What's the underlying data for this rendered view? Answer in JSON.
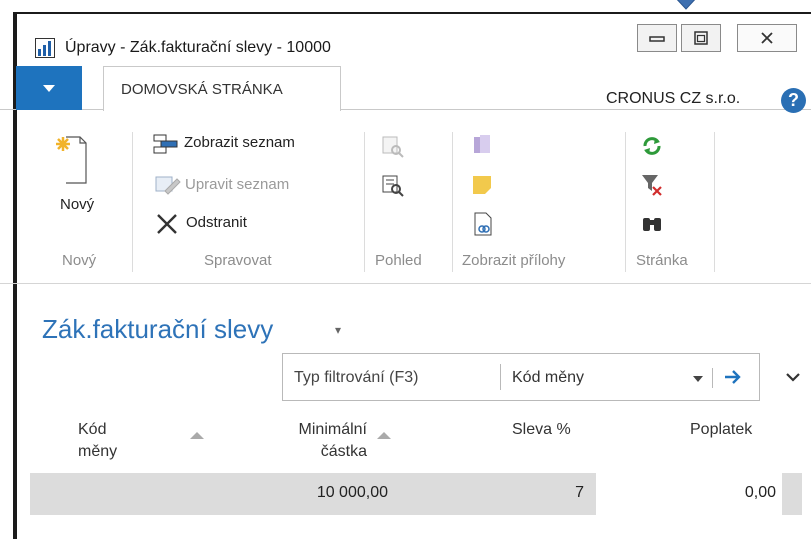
{
  "window": {
    "title": "Úpravy - Zák.fakturační slevy - 10000"
  },
  "tabs": {
    "home_label": "DOMOVSKÁ STRÁNKA",
    "company": "CRONUS CZ s.r.o.",
    "help": "?"
  },
  "ribbon": {
    "new_button": "Nový",
    "show_list": "Zobrazit seznam",
    "edit_list": "Upravit seznam",
    "delete": "Odstranit",
    "groups": {
      "new": "Nový",
      "manage": "Spravovat",
      "view": "Pohled",
      "attachments": "Zobrazit přílohy",
      "page": "Stránka"
    }
  },
  "page": {
    "title": "Zák.fakturační slevy",
    "title_dropdown": "▾"
  },
  "filter": {
    "placeholder": "Typ filtrování (F3)",
    "field": "Kód měny"
  },
  "table": {
    "columns": {
      "currency_code_line1": "Kód",
      "currency_code_line2": "měny",
      "min_amount_line1": "Minimální",
      "min_amount_line2": "částka",
      "discount": "Sleva %",
      "fee": "Poplatek"
    },
    "rows": [
      {
        "currency_code": "",
        "min_amount": "10 000,00",
        "discount": "7",
        "fee": "0,00"
      }
    ]
  },
  "colors": {
    "accent": "#1e73be",
    "title_blue": "#2e73b8",
    "row_highlight": "#dcdcdc"
  }
}
